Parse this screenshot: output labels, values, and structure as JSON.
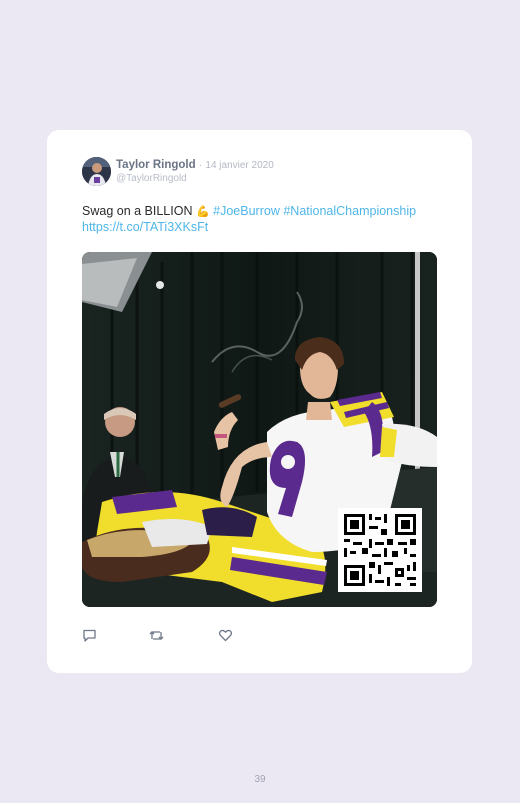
{
  "tweet": {
    "display_name": "Taylor Ringold",
    "separator": "·",
    "date": "14 janvier 2020",
    "handle": "@TaylorRingold",
    "text": "Swag on a BILLION",
    "emoji": "💪",
    "hashtags": [
      "#JoeBurrow",
      "#NationalChampionship"
    ],
    "link": "https://t.co/TATi3XKsFt",
    "media": {
      "jersey_number": "9",
      "qr_code": "qr-code"
    },
    "actions": [
      {
        "name": "reply",
        "icon": "reply-icon"
      },
      {
        "name": "retweet",
        "icon": "retweet-icon"
      },
      {
        "name": "like",
        "icon": "heart-icon"
      }
    ]
  },
  "page_number": "39",
  "colors": {
    "background": "#ebe8f4",
    "card": "#ffffff",
    "link": "#4fb6e8",
    "name": "#6b7486",
    "muted": "#b4b9c3"
  }
}
